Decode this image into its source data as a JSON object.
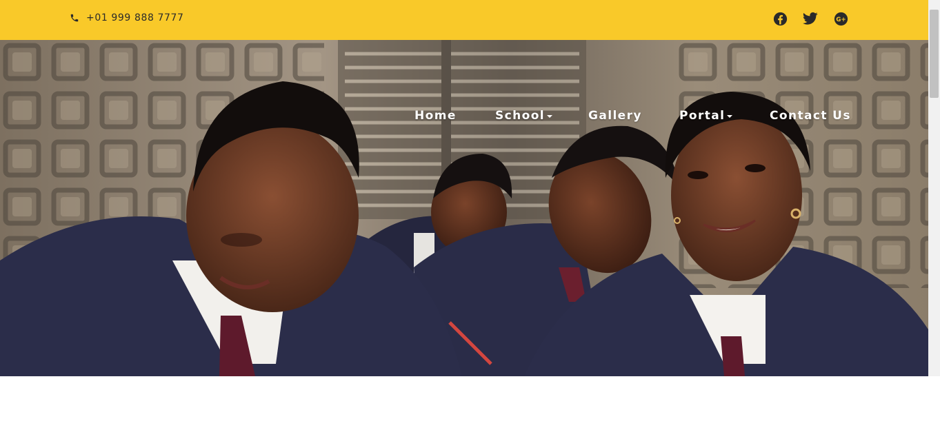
{
  "topbar": {
    "phone": "+01 999 888 7777",
    "phone_icon": "phone-icon",
    "social": [
      {
        "name": "facebook",
        "icon": "facebook-icon"
      },
      {
        "name": "twitter",
        "icon": "twitter-icon"
      },
      {
        "name": "google-plus",
        "icon": "google-plus-icon"
      }
    ],
    "background_color": "#f9c929"
  },
  "nav": {
    "items": [
      {
        "label": "Home",
        "dropdown": false
      },
      {
        "label": "School",
        "dropdown": true
      },
      {
        "label": "Gallery",
        "dropdown": false
      },
      {
        "label": "Portal",
        "dropdown": true
      },
      {
        "label": "Contact Us",
        "dropdown": false
      }
    ]
  },
  "hero": {
    "image": "students-in-classroom-photo"
  }
}
